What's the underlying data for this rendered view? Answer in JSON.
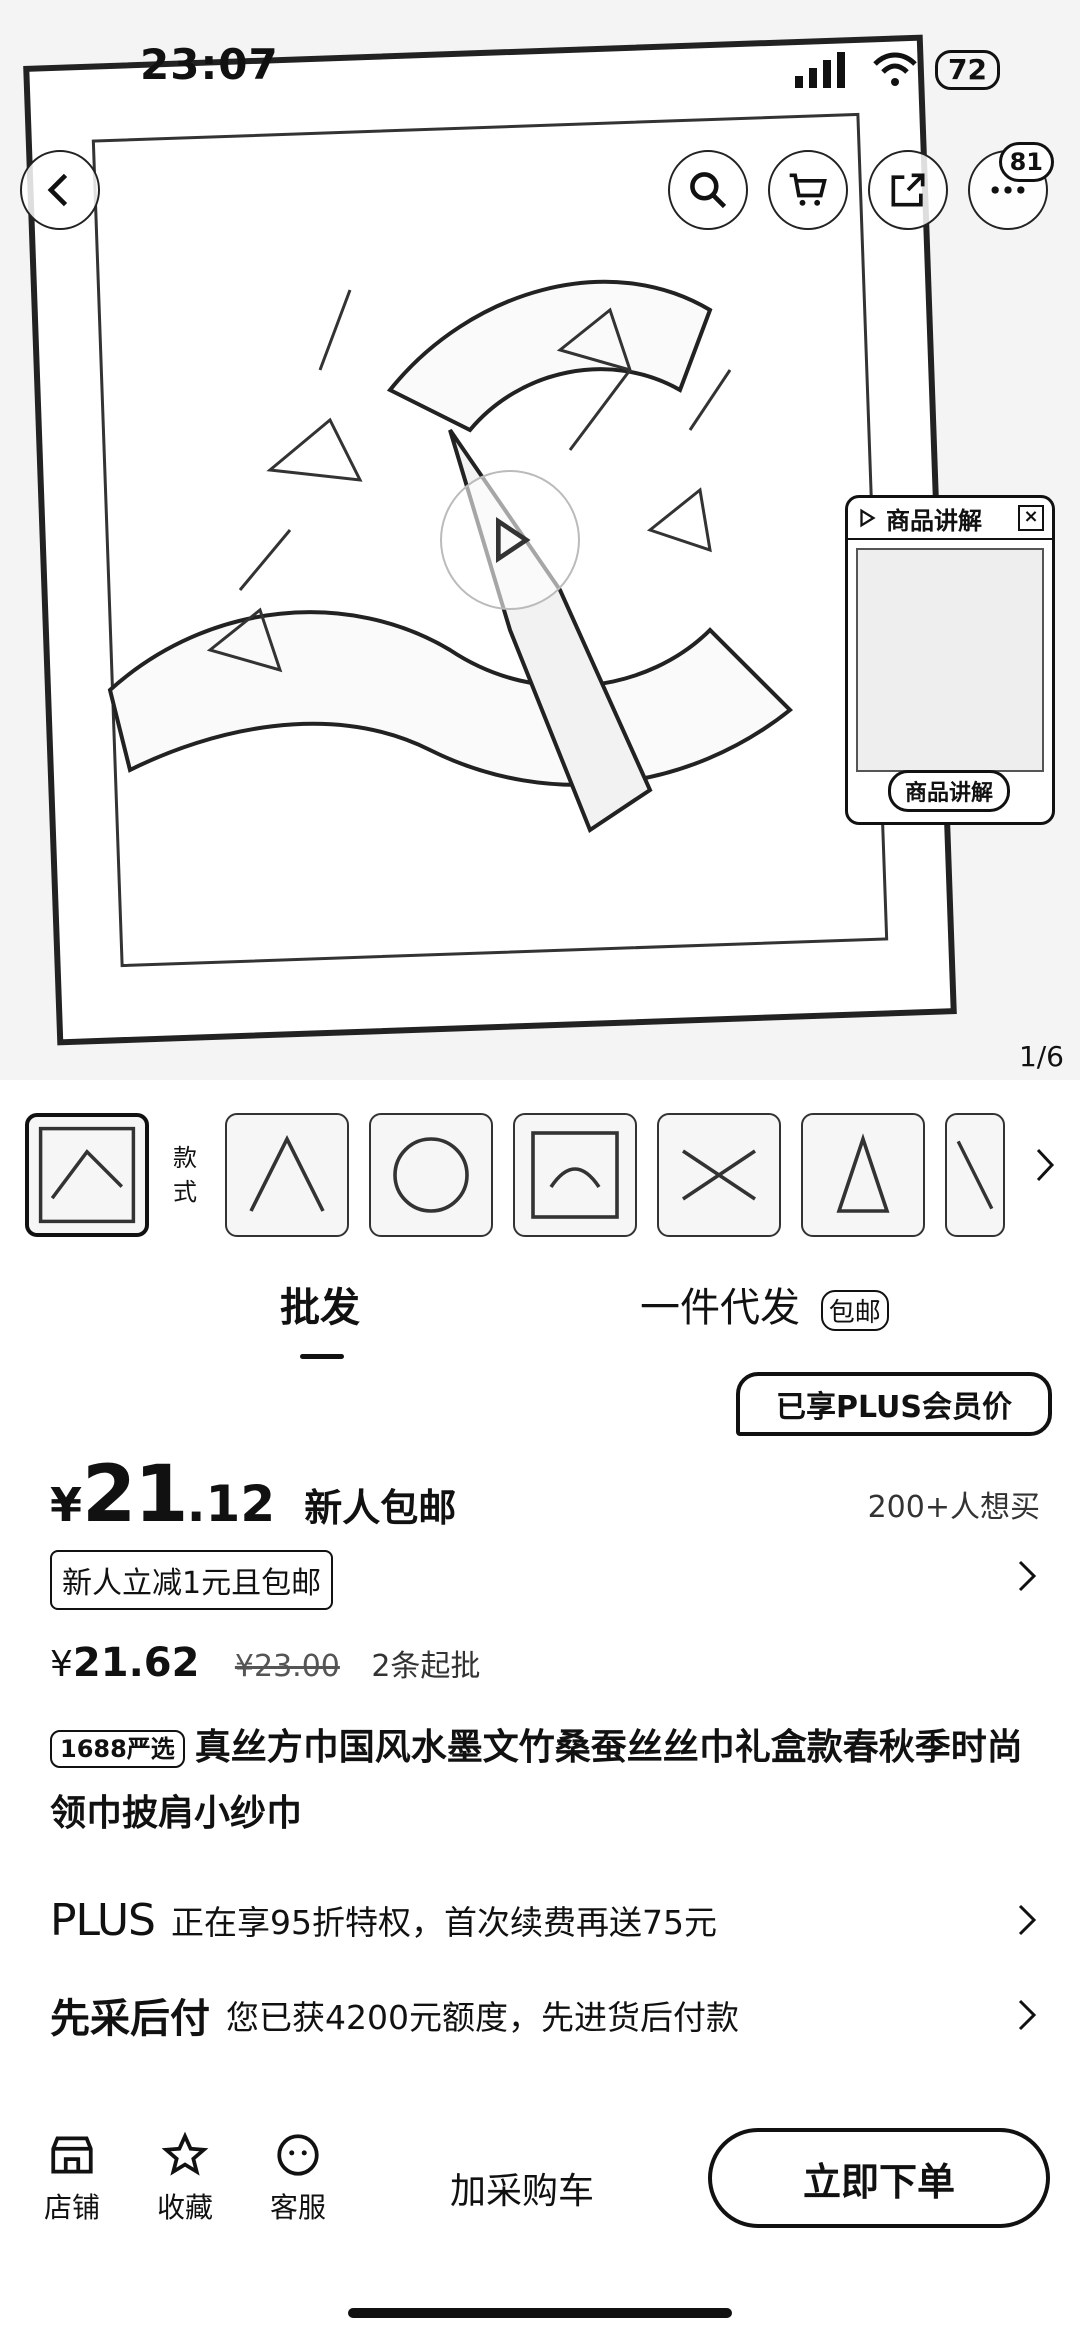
{
  "status_bar": {
    "time": "23:07",
    "battery": "72"
  },
  "header": {
    "cart_badge": "81"
  },
  "pip": {
    "title": "商品讲解",
    "close": "×",
    "footer": "商品讲解"
  },
  "gallery": {
    "page_indicator": "1/6"
  },
  "variants": {
    "label": "款式"
  },
  "tabs": [
    {
      "label": "批发"
    },
    {
      "label": "一件代发",
      "badge": "包邮"
    }
  ],
  "plus_member": "已享PLUS会员价",
  "price": {
    "currency": "¥",
    "integer": "21",
    "fraction": ".12",
    "tag": "新人包邮",
    "want_buy": "200+人想买"
  },
  "promo": {
    "chip": "新人立减1元且包邮"
  },
  "sub_price": {
    "currency": "¥",
    "value": "21.62",
    "original": "¥23.00",
    "min_order": "2条起批"
  },
  "product": {
    "brand_tag": "1688严选",
    "title": "真丝方巾国风水墨文竹桑蚕丝丝巾礼盒款春秋季时尚领巾披肩小纱巾"
  },
  "rows": {
    "plus": {
      "lead": "PLUS",
      "text": "正在享95折特权，首次续费再送75元"
    },
    "paylater": {
      "lead": "先采后付",
      "text": "您已获4200元额度，先进货后付款"
    }
  },
  "bottom_bar": {
    "shop": "店铺",
    "favorite": "收藏",
    "service": "客服",
    "add_cart": "加采购车",
    "buy_now": "立即下单"
  }
}
